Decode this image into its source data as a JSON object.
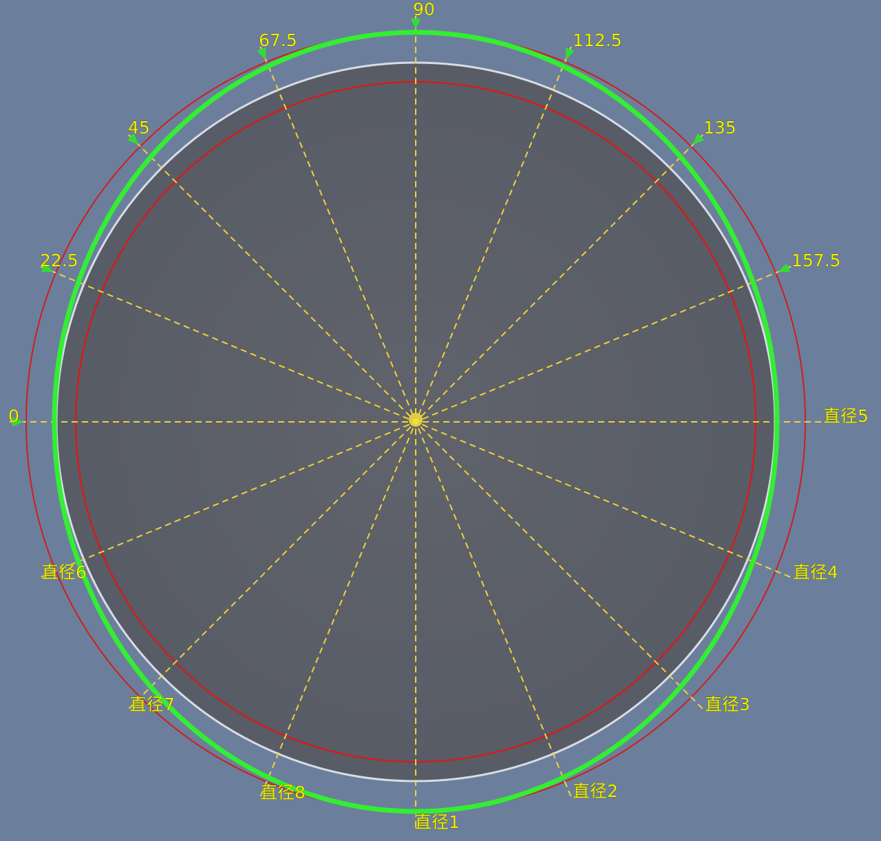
{
  "colors": {
    "background": "#6b7f9c",
    "disk_fill": "#5d6068",
    "inner_red_circle": "#d11d1d",
    "outer_red_circle": "#d11d1d",
    "white_circle": "#d8dde6",
    "green_profile": "#33ee33",
    "ray": "#f2d23a",
    "label_text": "#f4f000",
    "arrow_marker": "#33dd33"
  },
  "angle_labels": [
    {
      "id": "a0",
      "text": "0"
    },
    {
      "id": "a22",
      "text": "22.5"
    },
    {
      "id": "a45",
      "text": "45"
    },
    {
      "id": "a67",
      "text": "67.5"
    },
    {
      "id": "a90",
      "text": "90"
    },
    {
      "id": "a112",
      "text": "112.5"
    },
    {
      "id": "a135",
      "text": "135"
    },
    {
      "id": "a157",
      "text": "157.5"
    }
  ],
  "diameter_labels": [
    {
      "id": "d1",
      "text": "直径1"
    },
    {
      "id": "d2",
      "text": "直径2"
    },
    {
      "id": "d3",
      "text": "直径3"
    },
    {
      "id": "d4",
      "text": "直径4"
    },
    {
      "id": "d5",
      "text": "直径5"
    },
    {
      "id": "d6",
      "text": "直径6"
    },
    {
      "id": "d7",
      "text": "直径7"
    },
    {
      "id": "d8",
      "text": "直径8"
    }
  ]
}
